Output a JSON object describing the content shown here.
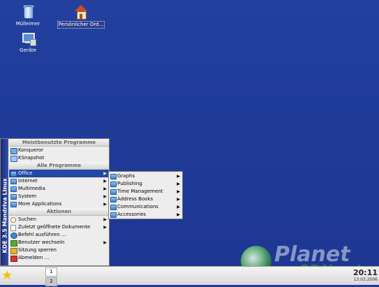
{
  "desktop": {
    "icons": [
      {
        "label": "Mülleimer",
        "icon": "trash-icon"
      },
      {
        "label": "Persönlicher Ord...",
        "icon": "home-folder-icon"
      },
      {
        "label": "Geräte",
        "icon": "devices-icon"
      }
    ]
  },
  "kmenu": {
    "side_label": "KDE 3.5 Mandriva Linux",
    "section_frequent": "Meistbenutzte Programme",
    "frequent": [
      {
        "label": "Konqueror"
      },
      {
        "label": "KSnapshot"
      }
    ],
    "section_all": "Alle Programme",
    "all": [
      {
        "label": "Office"
      },
      {
        "label": "Internet"
      },
      {
        "label": "Multimedia"
      },
      {
        "label": "System"
      },
      {
        "label": "More Applications"
      }
    ],
    "section_actions": "Aktionen",
    "actions": [
      {
        "label": "Suchen"
      },
      {
        "label": "Zuletzt geöffnete Dokumente"
      },
      {
        "label": "Befehl ausführen ..."
      },
      {
        "label": "Benutzer wechseln"
      },
      {
        "label": "Sitzung sperren"
      },
      {
        "label": "Abmelden ..."
      }
    ]
  },
  "office_submenu": [
    {
      "label": "Graphs"
    },
    {
      "label": "Publishing"
    },
    {
      "label": "Time Management"
    },
    {
      "label": "Address Books"
    },
    {
      "label": "Communications"
    },
    {
      "label": "Accessories"
    }
  ],
  "taskbar": {
    "pager": [
      "1",
      "2"
    ],
    "clock_time": "20:11",
    "clock_date": "13.03.2006"
  },
  "watermark": {
    "planet": "Planet",
    "brand": "3DNow!"
  },
  "colors": {
    "desktop_bg": "#1f3a97",
    "highlight": "#2348a6",
    "menu_bg": "#ededed"
  }
}
